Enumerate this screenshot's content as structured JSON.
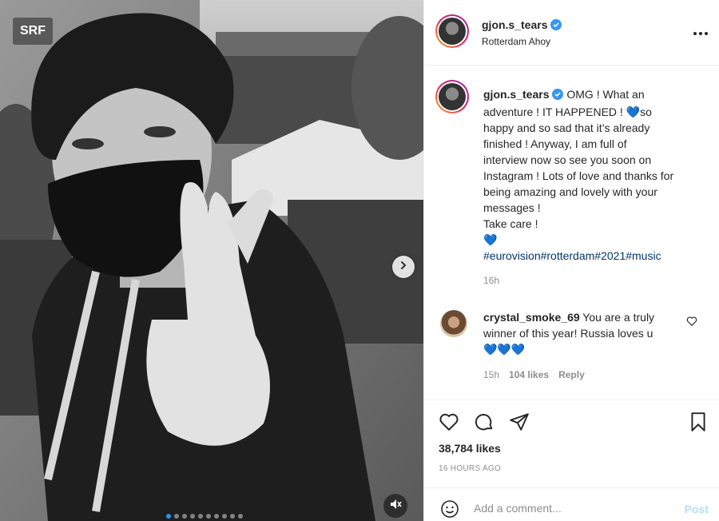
{
  "media": {
    "watermark": "SRF",
    "carousel_count": 10,
    "carousel_active": 0
  },
  "post": {
    "username": "gjon.s_tears",
    "location": "Rotterdam Ahoy",
    "caption_lines": [
      "OMG ! What an",
      "adventure ! IT HAPPENED ! ",
      "so",
      "happy and so sad that it’s already",
      "finished ! Anyway, I am full of",
      "interview now so see you soon on",
      "Instagram ! Lots of love and thanks for",
      "being amazing and lovely with your",
      "messages !",
      "Take care !"
    ],
    "caption_emoji": "💙",
    "hashtags": "#eurovision#rotterdam#2021#music",
    "caption_time": "16h"
  },
  "comment": {
    "username": "crystal_smoke_69",
    "text_1": "You are a truly",
    "text_2": "winner of this year! Russia loves u",
    "emoji": "💙💙💙",
    "time": "15h",
    "likes": "104 likes",
    "reply": "Reply"
  },
  "stats": {
    "likes": "38,784 likes",
    "time_ago": "16 HOURS AGO"
  },
  "composer": {
    "placeholder": "Add a comment...",
    "post_label": "Post"
  },
  "colors": {
    "verified": "#3897f0",
    "link": "#00376b",
    "post_disabled": "#b2dffc"
  },
  "icons": [
    "heart-icon",
    "comment-icon",
    "share-icon",
    "bookmark-icon",
    "smiley-icon",
    "mute-icon",
    "chevron-right-icon",
    "more-icon",
    "verified-icon"
  ]
}
